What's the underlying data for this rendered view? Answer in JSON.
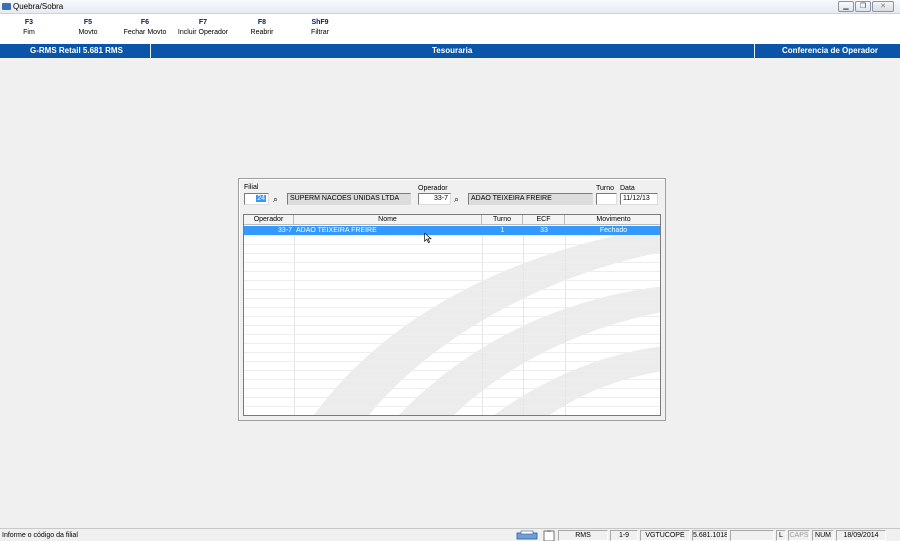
{
  "window": {
    "title": "Quebra/Sobra"
  },
  "toolbar": [
    {
      "key": "F3",
      "label": "Fim"
    },
    {
      "key": "F5",
      "label": "Movto"
    },
    {
      "key": "F6",
      "label": "Fechar Movto"
    },
    {
      "key": "F7",
      "label": "Incluir Operador"
    },
    {
      "key": "F8",
      "label": "Reabrir"
    },
    {
      "key": "ShF9",
      "label": "Filtrar"
    }
  ],
  "banner": {
    "left": "G-RMS Retail 5.681 RMS",
    "center": "Tesouraria",
    "right": "Conferencia de Operador"
  },
  "filters": {
    "filial_label": "Filial",
    "filial_value": "24",
    "filial_name": "SUPERM NACOES UNIDAS LTDA",
    "operador_label": "Operador",
    "operador_value": "33-7",
    "operador_name": "ADAO TEIXEIRA FREIRE",
    "turno_label": "Turno",
    "turno_value": "",
    "data_label": "Data",
    "data_value": "11/12/13"
  },
  "grid": {
    "columns": [
      "Operador",
      "Nome",
      "Turno",
      "ECF",
      "Movimento"
    ],
    "rows": [
      {
        "operador": "33-7",
        "nome": "ADAO TEIXEIRA FREIRE",
        "turno": "1",
        "ecf": "33",
        "movimento": "Fechado"
      }
    ]
  },
  "statusbar": {
    "message": "Informe o código da filial",
    "user": "RMS",
    "range": "1-9",
    "program": "VGTUCOPE",
    "version": "5.681.1018",
    "lock": "L",
    "caps": "CAPS",
    "num": "NUM",
    "date": "18/09/2014"
  },
  "colors": {
    "banner": "#0a55a8",
    "selection": "#3399ff",
    "fkey": "#001a66"
  },
  "icons": {
    "search": "binoculars-icon",
    "app": "app-icon"
  }
}
